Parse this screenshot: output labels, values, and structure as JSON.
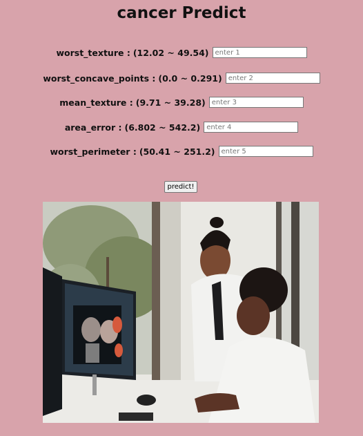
{
  "page": {
    "title": "cancer Predict"
  },
  "fields": [
    {
      "label": "worst_texture :",
      "range": "(12.02 ~ 49.54)",
      "placeholder": "enter 1"
    },
    {
      "label": "worst_concave_points :",
      "range": "(0.0 ~ 0.291)",
      "placeholder": "enter 2"
    },
    {
      "label": "mean_texture :",
      "range": "(9.71 ~ 39.28)",
      "placeholder": "enter 3"
    },
    {
      "label": "area_error :",
      "range": "(6.802 ~ 542.2)",
      "placeholder": "enter 4"
    },
    {
      "label": "worst_perimeter :",
      "range": "(50.41 ~ 251.2)",
      "placeholder": "enter 5"
    }
  ],
  "form": {
    "submit_label": "predict!"
  },
  "image": {
    "subject": "two doctors reviewing CT scans on a monitor"
  },
  "colors": {
    "background": "#d8a3ab"
  }
}
